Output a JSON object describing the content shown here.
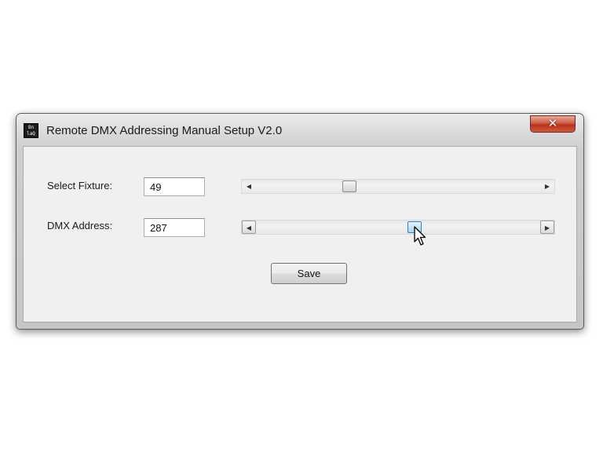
{
  "window": {
    "title": "Remote DMX Addressing Manual Setup V2.0",
    "close_label": "✕",
    "icon_name": "app-logo-icon",
    "icon_glyph": "8n\nlaQ"
  },
  "fixture": {
    "label": "Select Fixture:",
    "value": "49",
    "slider_fraction": 0.32
  },
  "address": {
    "label": "DMX Address:",
    "value": "287",
    "slider_fraction": 0.56
  },
  "save_label": "Save",
  "arrows": {
    "left": "◀",
    "right": "▶"
  },
  "colors": {
    "close_red": "#c7432a",
    "thumb_hover": "#a9d4f1",
    "client_bg": "#f0f0f0"
  }
}
